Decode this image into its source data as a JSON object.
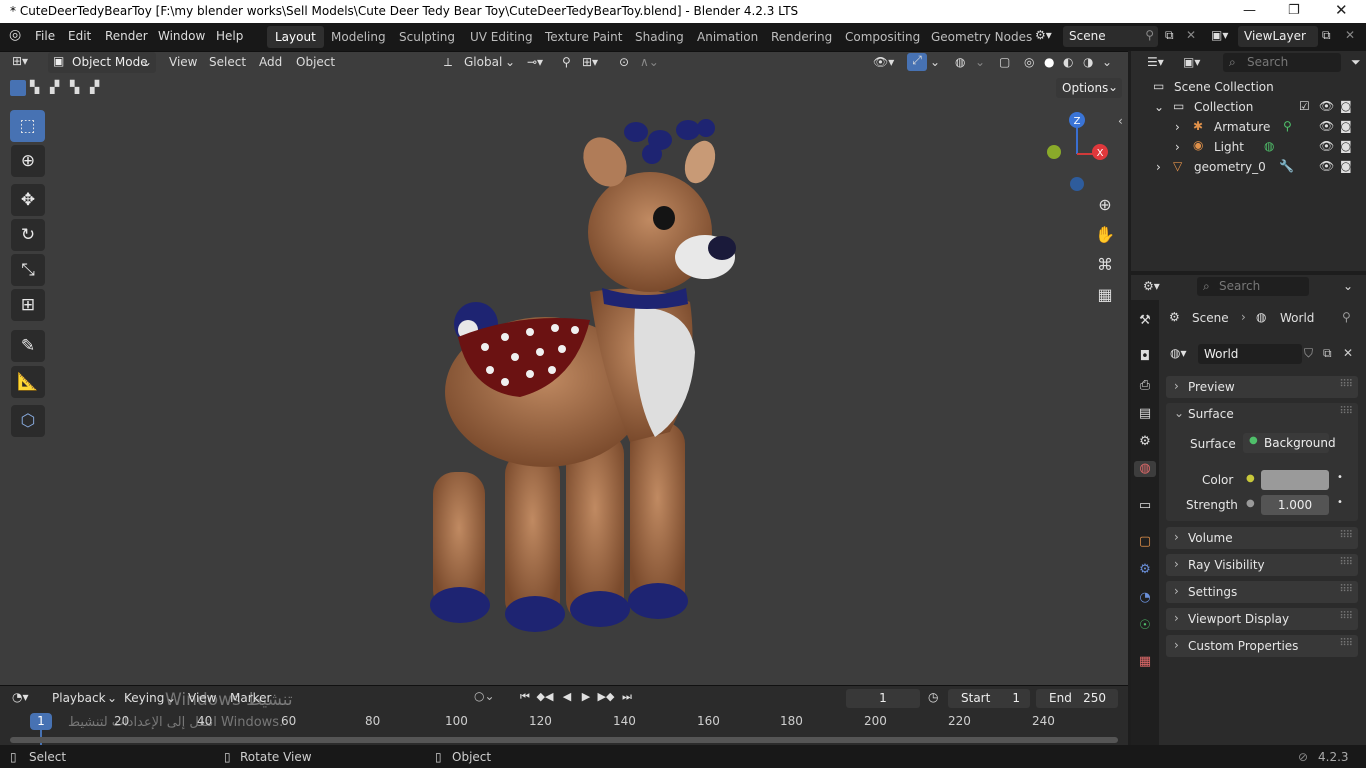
{
  "window": {
    "title": "* CuteDeerTedyBearToy [F:\\my blender works\\Sell Models\\Cute Deer Tedy Bear Toy\\CuteDeerTedyBearToy.blend] - Blender 4.2.3 LTS"
  },
  "menu": [
    "File",
    "Edit",
    "Render",
    "Window",
    "Help"
  ],
  "workspaces": [
    "Layout",
    "Modeling",
    "Sculpting",
    "UV Editing",
    "Texture Paint",
    "Shading",
    "Animation",
    "Rendering",
    "Compositing",
    "Geometry Nodes"
  ],
  "active_workspace": "Layout",
  "scene_name": "Scene",
  "view_layer": "ViewLayer",
  "viewport_header": {
    "mode": "Object Mode",
    "menus": [
      "View",
      "Select",
      "Add",
      "Object"
    ],
    "orientation": "Global",
    "options_label": "Options"
  },
  "gizmo": {
    "z": "Z",
    "x": "X"
  },
  "outliner": {
    "search_placeholder": "Search",
    "root": "Scene Collection",
    "collection": "Collection",
    "items": [
      "Armature",
      "Light",
      "geometry_0"
    ]
  },
  "properties": {
    "search_placeholder": "Search",
    "breadcrumb": [
      "Scene",
      "World"
    ],
    "world_name": "World",
    "panels": {
      "preview": "Preview",
      "surface": "Surface",
      "volume": "Volume",
      "ray_visibility": "Ray Visibility",
      "settings": "Settings",
      "viewport_display": "Viewport Display",
      "custom_properties": "Custom Properties"
    },
    "surface_label": "Surface",
    "surface_value": "Background",
    "color_label": "Color",
    "color_value": "#9a9a9a",
    "strength_label": "Strength",
    "strength_value": "1.000"
  },
  "timeline": {
    "menus": [
      "Playback",
      "Keying",
      "View",
      "Marker"
    ],
    "current_frame": "1",
    "start_label": "Start",
    "start_value": "1",
    "end_label": "End",
    "end_value": "250",
    "ticks": [
      "20",
      "40",
      "60",
      "80",
      "100",
      "120",
      "140",
      "160",
      "180",
      "200",
      "220",
      "240"
    ],
    "playhead": "1"
  },
  "watermark": {
    "line1": "Windows تنشيط",
    "line2": "انتقل إلى الإعدادات لتنشيط Windows."
  },
  "status": {
    "select": "Select",
    "rotate": "Rotate View",
    "object": "Object",
    "version": "4.2.3"
  }
}
